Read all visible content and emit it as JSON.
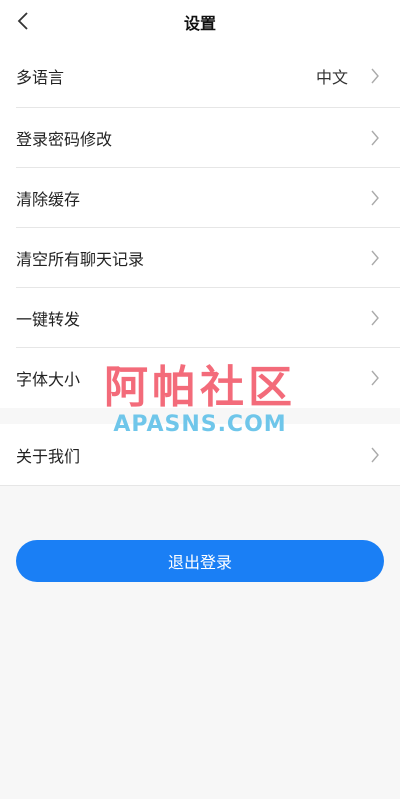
{
  "header": {
    "title": "设置"
  },
  "settings": {
    "items": [
      {
        "label": "多语言",
        "value": "中文"
      },
      {
        "label": "登录密码修改"
      },
      {
        "label": "清除缓存"
      },
      {
        "label": "清空所有聊天记录"
      },
      {
        "label": "一键转发"
      },
      {
        "label": "字体大小"
      }
    ],
    "about": {
      "label": "关于我们"
    }
  },
  "logout": {
    "label": "退出登录"
  },
  "watermark": {
    "cn": "阿帕社区",
    "en": "APASNS.COM"
  },
  "colors": {
    "accent": "#1a7ff5",
    "background": "#f7f7f7",
    "divider": "#e6e6e6"
  }
}
